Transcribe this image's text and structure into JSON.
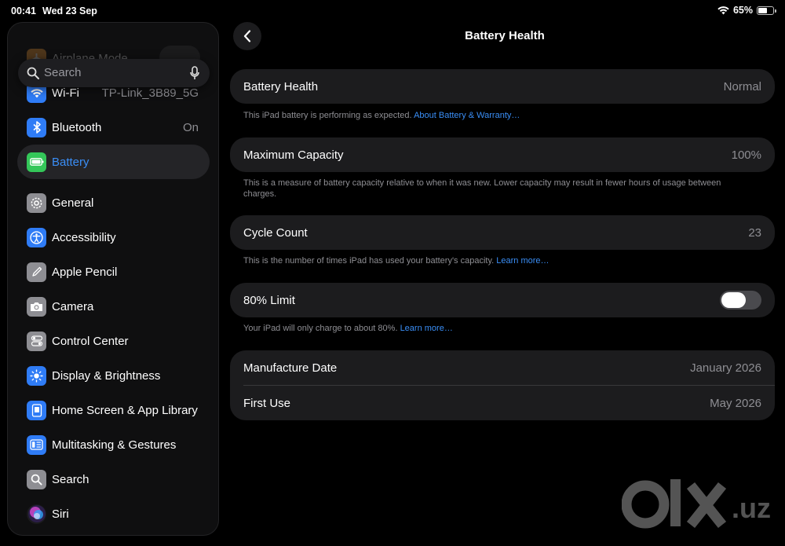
{
  "status_bar": {
    "time": "00:41",
    "date": "Wed 23 Sep",
    "battery_percent_label": "65%",
    "battery_level": 0.65
  },
  "sidebar": {
    "search_placeholder": "Search",
    "items": [
      {
        "label": "Airplane Mode",
        "value": "",
        "icon": "airplane-icon",
        "color": "#f29a38"
      },
      {
        "label": "Wi-Fi",
        "value": "TP-Link_3B89_5G",
        "icon": "wifi-icon",
        "color": "#2f7cf6"
      },
      {
        "label": "Bluetooth",
        "value": "On",
        "icon": "bluetooth-icon",
        "color": "#2f7cf6"
      },
      {
        "label": "Battery",
        "value": "",
        "icon": "battery-icon",
        "color": "#34c759"
      },
      {
        "label": "General",
        "value": "",
        "icon": "gear-icon",
        "color": "#8e8e93"
      },
      {
        "label": "Accessibility",
        "value": "",
        "icon": "accessibility-icon",
        "color": "#2f7cf6"
      },
      {
        "label": "Apple Pencil",
        "value": "",
        "icon": "pencil-icon",
        "color": "#8e8e93"
      },
      {
        "label": "Camera",
        "value": "",
        "icon": "camera-icon",
        "color": "#8e8e93"
      },
      {
        "label": "Control Center",
        "value": "",
        "icon": "control-center-icon",
        "color": "#8e8e93"
      },
      {
        "label": "Display & Brightness",
        "value": "",
        "icon": "sun-icon",
        "color": "#2f7cf6"
      },
      {
        "label": "Home Screen & App Library",
        "value": "",
        "icon": "home-screen-icon",
        "color": "#2f7cf6"
      },
      {
        "label": "Multitasking & Gestures",
        "value": "",
        "icon": "multitasking-icon",
        "color": "#2f7cf6"
      },
      {
        "label": "Search",
        "value": "",
        "icon": "search-icon",
        "color": "#8e8e93"
      },
      {
        "label": "Siri",
        "value": "",
        "icon": "siri-icon",
        "color": "#222"
      }
    ]
  },
  "main": {
    "title": "Battery Health",
    "health": {
      "label": "Battery Health",
      "value": "Normal",
      "footer": "This iPad battery is performing as expected. ",
      "footer_link": "About Battery & Warranty…"
    },
    "capacity": {
      "label": "Maximum Capacity",
      "value": "100%",
      "footer": "This is a measure of battery capacity relative to when it was new. Lower capacity may result in fewer hours of usage between charges."
    },
    "cycles": {
      "label": "Cycle Count",
      "value": "23",
      "footer": "This is the number of times iPad has used your battery's capacity. ",
      "footer_link": "Learn more…"
    },
    "limit": {
      "label": "80% Limit",
      "on": false,
      "footer": "Your iPad will only charge to about 80%. ",
      "footer_link": "Learn more…"
    },
    "dates": [
      {
        "label": "Manufacture Date",
        "value": "January 2026"
      },
      {
        "label": "First Use",
        "value": "May 2026"
      }
    ]
  },
  "watermark": {
    "text": "olx.uz"
  }
}
